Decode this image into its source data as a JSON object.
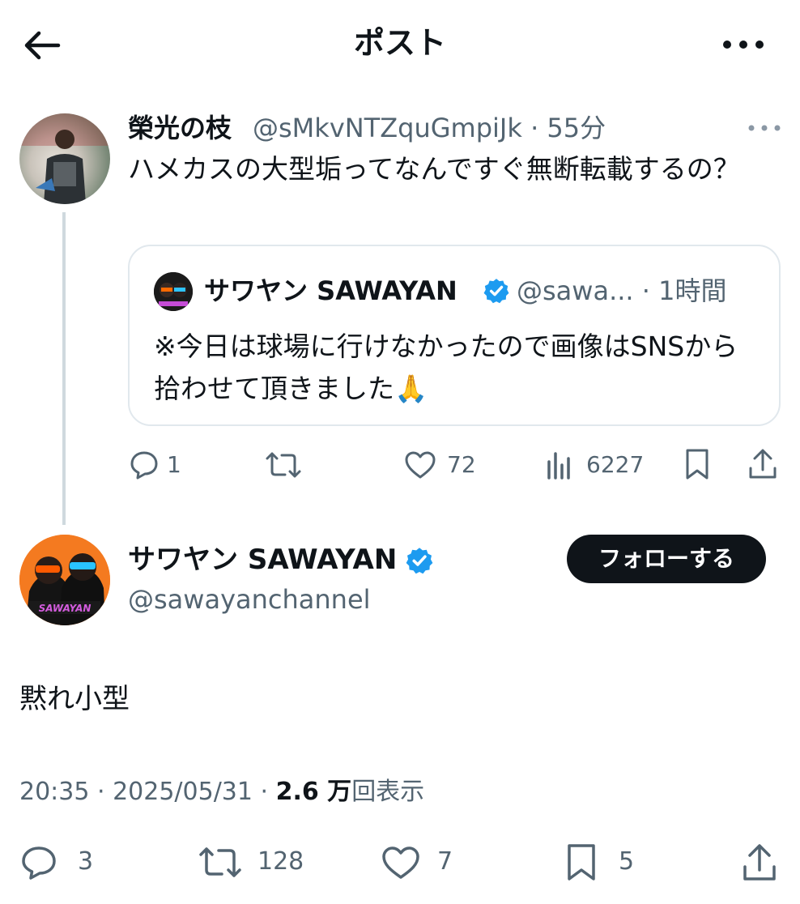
{
  "header": {
    "title": "ポスト"
  },
  "reply": {
    "author_name": "榮光の枝",
    "handle_time": "@sMkvNTZquGmpiJk · 55分",
    "text": "ハメカスの大型垢ってなんですぐ無断転載するの？",
    "quote": {
      "author_name": "サワヤン SAWAYAN",
      "handle_time": "@sawa... · 1時間",
      "text": "※今日は球場に行けなかったので画像はSNSから拾わせて頂きました🙏"
    },
    "actions": {
      "replies": "1",
      "likes": "72",
      "views": "6227"
    }
  },
  "post": {
    "author_name": "サワヤン SAWAYAN",
    "handle": "@sawayanchannel",
    "follow_label": "フォローする",
    "avatar_text": "SAWAYAN",
    "text": "黙れ小型",
    "time": "20:35 · 2025/05/31 · ",
    "views_count": "2.6 万",
    "views_label": "回表示",
    "actions": {
      "replies": "3",
      "reposts": "128",
      "likes": "7",
      "bookmarks": "5"
    }
  },
  "colors": {
    "verified": "#1d9bf0",
    "follow_bg": "#0f1419",
    "avatar_bg": "#f47a20"
  }
}
